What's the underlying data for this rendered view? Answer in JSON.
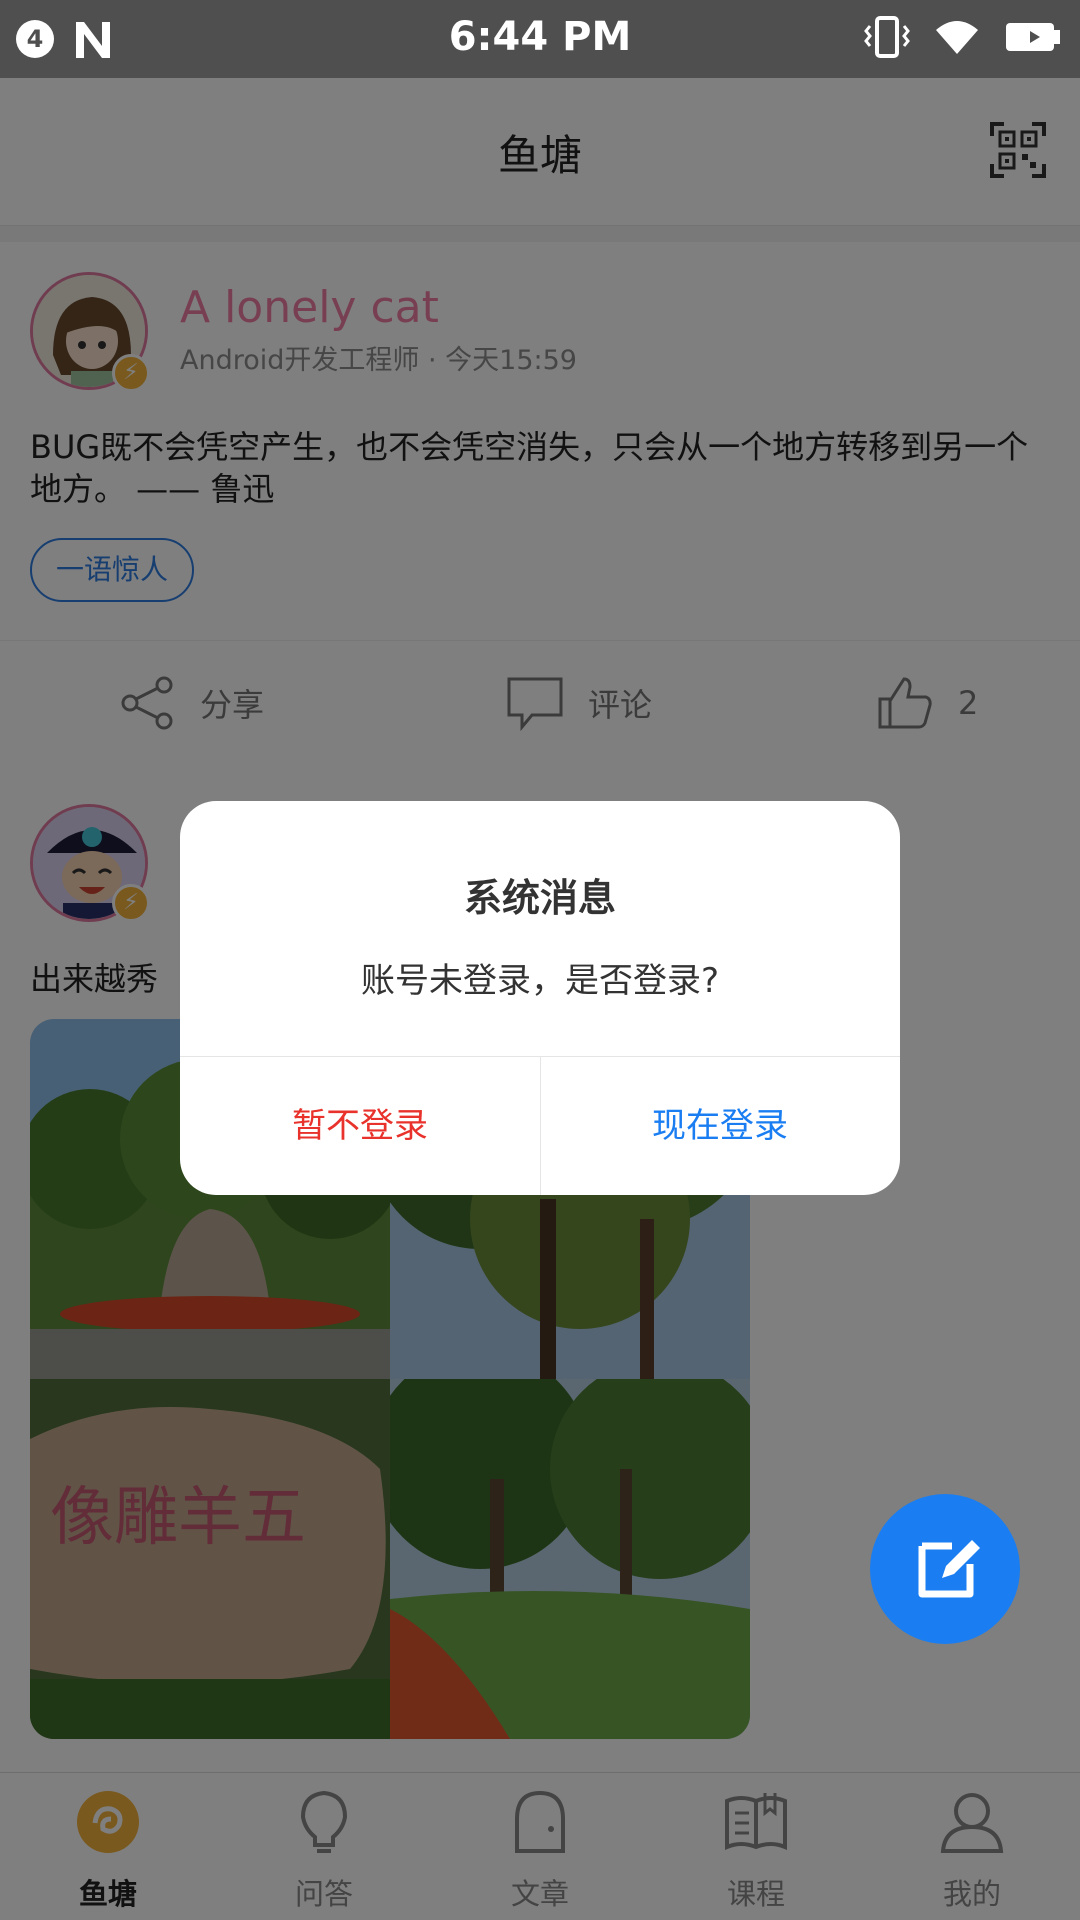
{
  "status_bar": {
    "notification_count": "4",
    "time": "6:44 PM",
    "icons": [
      "vibrate-icon",
      "wifi-icon",
      "battery-charging-icon"
    ]
  },
  "header": {
    "title": "鱼塘",
    "action_icon": "qr-code-icon"
  },
  "posts": [
    {
      "user_name": "A lonely cat",
      "meta": "Android开发工程师 · 今天15:59",
      "content": "BUG既不会凭空产生，也不会凭空消失，只会从一个地方转移到另一个地方。 —— 鲁迅",
      "tag": "一语惊人",
      "actions": {
        "share": "分享",
        "comment": "评论",
        "like_count": "2"
      }
    },
    {
      "content_visible": "出来越秀"
    }
  ],
  "bottom_nav": [
    {
      "label": "鱼塘",
      "icon": "fishpond-icon",
      "active": true
    },
    {
      "label": "问答",
      "icon": "lightbulb-icon",
      "active": false
    },
    {
      "label": "文章",
      "icon": "article-icon",
      "active": false
    },
    {
      "label": "课程",
      "icon": "book-icon",
      "active": false
    },
    {
      "label": "我的",
      "icon": "profile-icon",
      "active": false
    }
  ],
  "dialog": {
    "title": "系统消息",
    "message": "账号未登录，是否登录?",
    "cancel_label": "暂不登录",
    "confirm_label": "现在登录",
    "cancel_color": "#e8322b",
    "confirm_color": "#1a7ef2"
  },
  "colors": {
    "accent": "#1a7ef2",
    "username": "#f17fa4",
    "nav_active": "#f3b23a"
  }
}
